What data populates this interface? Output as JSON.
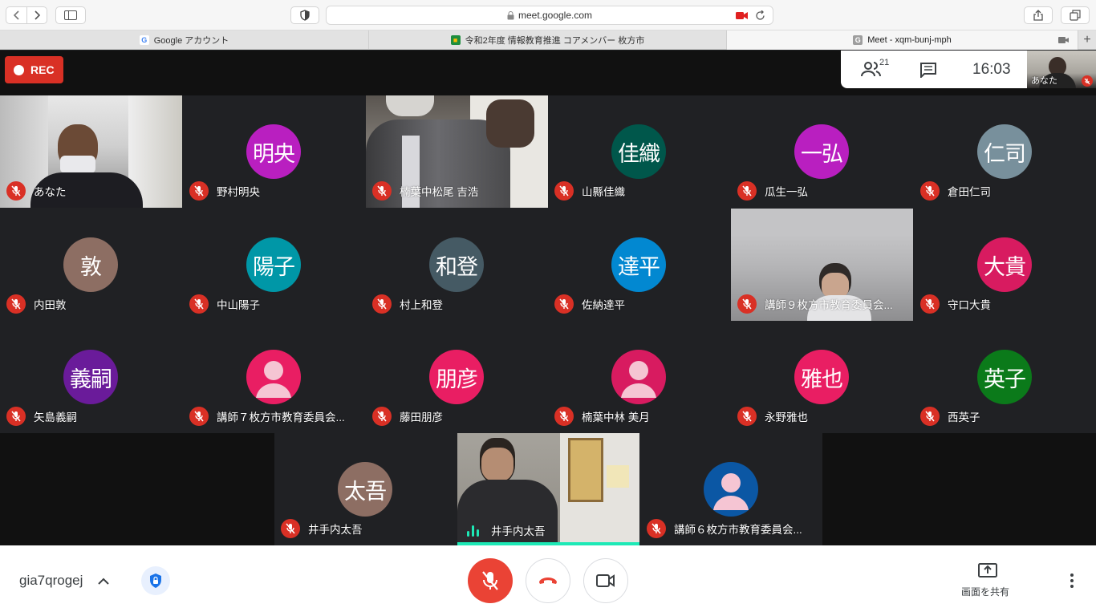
{
  "browser": {
    "url": "meet.google.com",
    "tabs": [
      {
        "label": "Google アカウント"
      },
      {
        "label": "令和2年度 情報教育推進 コアメンバー 枚方市"
      },
      {
        "label": "Meet - xqm-bunj-mph"
      }
    ]
  },
  "meet": {
    "rec_label": "REC",
    "participant_count": "21",
    "time": "16:03",
    "self_label": "あなた",
    "meeting_code": "gia7qrogej",
    "share_label": "画面を共有"
  },
  "tiles": [
    {
      "name": "あなた",
      "initials": "",
      "color": ""
    },
    {
      "name": "野村明央",
      "initials": "明央",
      "color": "#b91fc0"
    },
    {
      "name": "楠葉中松尾 吉浩",
      "initials": "",
      "color": ""
    },
    {
      "name": "山縣佳織",
      "initials": "佳織",
      "color": "#00574b"
    },
    {
      "name": "瓜生一弘",
      "initials": "一弘",
      "color": "#b91fc0"
    },
    {
      "name": "倉田仁司",
      "initials": "仁司",
      "color": "#78909c"
    },
    {
      "name": "内田敦",
      "initials": "敦",
      "color": "#8d6e63"
    },
    {
      "name": "中山陽子",
      "initials": "陽子",
      "color": "#0097a7"
    },
    {
      "name": "村上和登",
      "initials": "和登",
      "color": "#455a64"
    },
    {
      "name": "佐納達平",
      "initials": "達平",
      "color": "#0288d1"
    },
    {
      "name": "講師９枚方市教育委員会...",
      "initials": "",
      "color": ""
    },
    {
      "name": "守口大貴",
      "initials": "大貴",
      "color": "#d81b60"
    },
    {
      "name": "矢島義嗣",
      "initials": "義嗣",
      "color": "#6a1b9a"
    },
    {
      "name": "講師７枚方市教育委員会...",
      "initials": "",
      "color": "#e91e63"
    },
    {
      "name": "藤田朋彦",
      "initials": "朋彦",
      "color": "#e91e63"
    },
    {
      "name": "楠葉中林 美月",
      "initials": "",
      "color": "#d81b60"
    },
    {
      "name": "永野雅也",
      "initials": "雅也",
      "color": "#e91e63"
    },
    {
      "name": "西英子",
      "initials": "英子",
      "color": "#0b7a1a"
    },
    {
      "name": "井手内太吾",
      "initials": "太吾",
      "color": "#8d6e63"
    },
    {
      "name": "井手内太吾",
      "initials": "",
      "color": ""
    },
    {
      "name": "講師６枚方市教育委員会...",
      "initials": "",
      "color": "#0b57a4"
    }
  ]
}
